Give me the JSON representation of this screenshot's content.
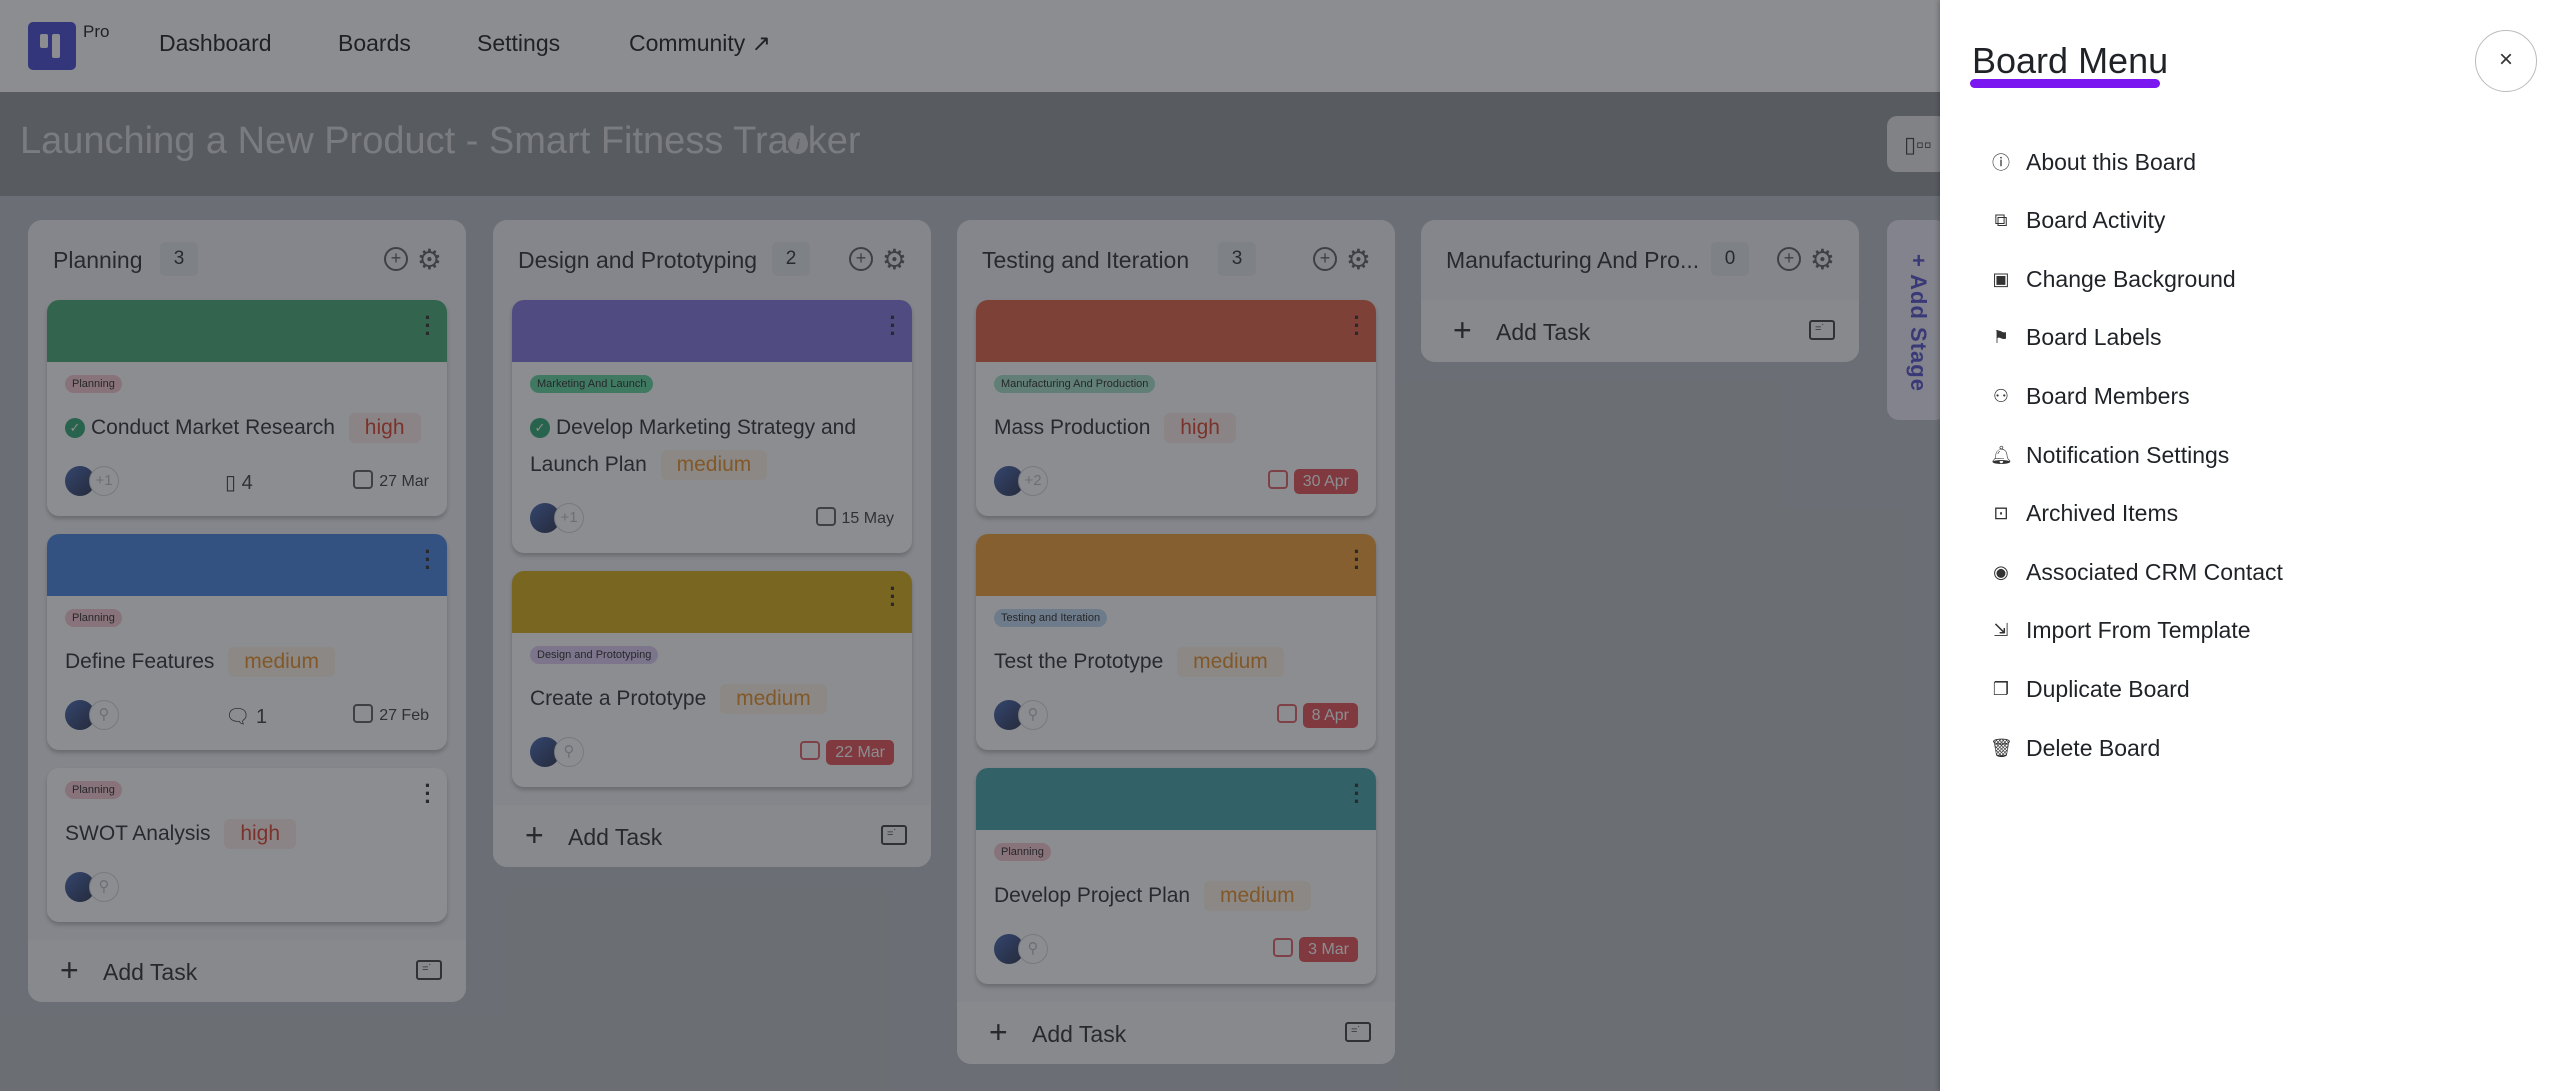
{
  "nav": {
    "logo_badge": "Pro",
    "links": [
      {
        "label": "Dashboard"
      },
      {
        "label": "Boards"
      },
      {
        "label": "Settings"
      },
      {
        "label": "Community ↗"
      }
    ]
  },
  "board": {
    "title": "Launching a New Product - Smart Fitness Tracker",
    "info_icon": "i",
    "view_toggle_icon": "kanban-icon",
    "add_stage_label": "+ Add Stage",
    "add_task_label": "Add Task",
    "columns": [
      {
        "name": "Planning",
        "count": "3",
        "cards": [
          {
            "cover_color": "#3aa76d",
            "tag": "Planning",
            "tag_bg": "#f3c6cc",
            "done": true,
            "title": "Conduct Market Research",
            "priority": "high",
            "extra_members": "+1",
            "meta_icon": "notebook-icon",
            "meta_value": "4",
            "due": "27 Mar",
            "overdue": false
          },
          {
            "cover_color": "#3b7ddd",
            "tag": "Planning",
            "tag_bg": "#f3c6cc",
            "done": false,
            "title": "Define Features",
            "priority": "medium",
            "extra_members": "",
            "meta_icon": "comment-icon",
            "meta_value": "1",
            "due": "27 Feb",
            "overdue": false
          },
          {
            "cover_color": "",
            "tag": "Planning",
            "tag_bg": "#f3c6cc",
            "done": false,
            "title": "SWOT Analysis",
            "priority": "high",
            "extra_members": "",
            "meta_icon": "",
            "meta_value": "",
            "due": "",
            "overdue": false
          }
        ]
      },
      {
        "name": "Design and Prototyping",
        "count": "2",
        "cards": [
          {
            "cover_color": "#7a6fe0",
            "tag": "Marketing And Launch",
            "tag_bg": "#57d39a",
            "done": true,
            "title": "Develop Marketing Strategy and Launch Plan",
            "priority": "medium",
            "extra_members": "+1",
            "meta_icon": "",
            "meta_value": "",
            "due": "15 May",
            "overdue": false
          },
          {
            "cover_color": "#d4a80a",
            "tag": "Design and Prototyping",
            "tag_bg": "#dccbf3",
            "done": false,
            "title": "Create a Prototype",
            "priority": "medium",
            "extra_members": "",
            "meta_icon": "",
            "meta_value": "",
            "due": "22 Mar",
            "overdue": true
          }
        ]
      },
      {
        "name": "Testing and Iteration",
        "count": "3",
        "cards": [
          {
            "cover_color": "#e0573c",
            "tag": "Manufacturing And Production",
            "tag_bg": "#9fdec7",
            "done": false,
            "title": "Mass Production",
            "priority": "high",
            "extra_members": "+2",
            "meta_icon": "",
            "meta_value": "",
            "due": "30 Apr",
            "overdue": true
          },
          {
            "cover_color": "#f09a2c",
            "tag": "Testing and Iteration",
            "tag_bg": "#bcd7f2",
            "done": false,
            "title": "Test the Prototype",
            "priority": "medium",
            "extra_members": "",
            "meta_icon": "",
            "meta_value": "",
            "due": "8 Apr",
            "overdue": true
          },
          {
            "cover_color": "#3a9ea6",
            "tag": "Planning",
            "tag_bg": "#f3c6cc",
            "done": false,
            "title": "Develop Project Plan",
            "priority": "medium",
            "extra_members": "",
            "meta_icon": "",
            "meta_value": "",
            "due": "3 Mar",
            "overdue": true
          }
        ]
      },
      {
        "name": "Manufacturing And Pro...",
        "count": "0",
        "cards": []
      }
    ]
  },
  "drawer": {
    "title": "Board Menu",
    "close_icon": "×",
    "accent": "#7a16f0",
    "items": [
      {
        "icon": "info-icon",
        "glyph": "ⓘ",
        "label": "About this Board"
      },
      {
        "icon": "activity-icon",
        "glyph": "⧉",
        "label": "Board Activity"
      },
      {
        "icon": "background-icon",
        "glyph": "▣",
        "label": "Change Background"
      },
      {
        "icon": "flag-icon",
        "glyph": "⚑",
        "label": "Board Labels"
      },
      {
        "icon": "members-icon",
        "glyph": "⚇",
        "label": "Board Members"
      },
      {
        "icon": "bell-icon",
        "glyph": "🔔︎",
        "label": "Notification Settings"
      },
      {
        "icon": "archive-icon",
        "glyph": "⊡",
        "label": "Archived Items"
      },
      {
        "icon": "contact-icon",
        "glyph": "◉",
        "label": "Associated CRM Contact"
      },
      {
        "icon": "import-icon",
        "glyph": "⇲",
        "label": "Import From Template"
      },
      {
        "icon": "duplicate-icon",
        "glyph": "❐",
        "label": "Duplicate Board"
      },
      {
        "icon": "trash-icon",
        "glyph": "🗑︎",
        "label": "Delete Board"
      }
    ]
  }
}
